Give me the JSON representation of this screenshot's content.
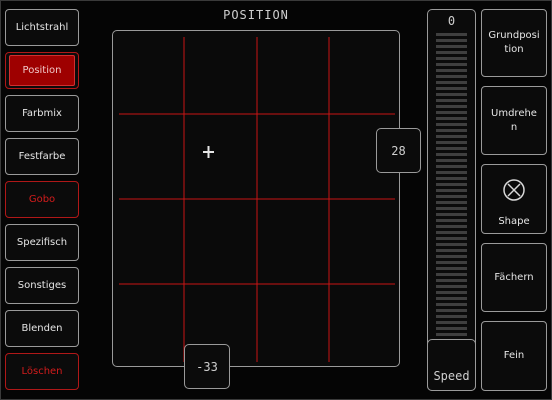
{
  "left_menu": [
    {
      "label": "Lichtstrahl",
      "style": "normal"
    },
    {
      "label": "Position",
      "style": "active"
    },
    {
      "label": "Farbmix",
      "style": "normal"
    },
    {
      "label": "Festfarbe",
      "style": "normal"
    },
    {
      "label": "Gobo",
      "style": "red"
    },
    {
      "label": "Spezifisch",
      "style": "normal"
    },
    {
      "label": "Sonstiges",
      "style": "normal"
    },
    {
      "label": "Blenden",
      "style": "normal"
    },
    {
      "label": "Löschen",
      "style": "red"
    }
  ],
  "pad": {
    "title": "POSITION",
    "tilt_value": "28",
    "pan_value": "-33"
  },
  "slider": {
    "value": "0",
    "label": "Speed"
  },
  "right_menu": [
    {
      "label": "Grundposition"
    },
    {
      "label": "Umdrehen"
    },
    {
      "label": "Shape",
      "icon": "shape-icon"
    },
    {
      "label": "Fächern"
    },
    {
      "label": "Fein"
    }
  ],
  "colors": {
    "grid_line": "#c81414",
    "active_button": "#9e0000",
    "red_text": "#d41c1c"
  }
}
